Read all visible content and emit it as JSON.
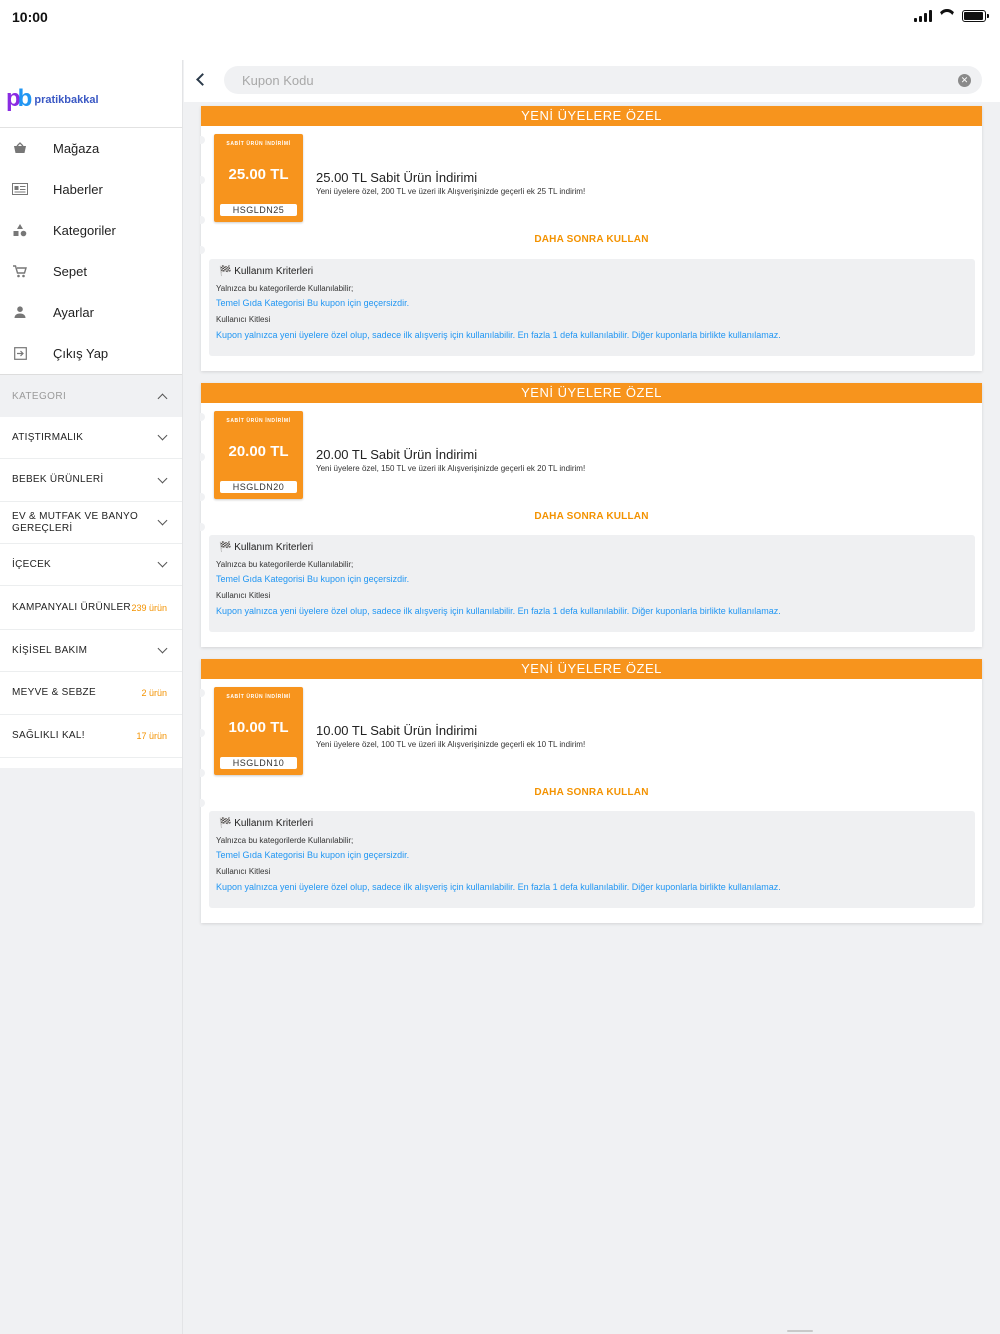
{
  "status": {
    "time": "10:00",
    "battery_level": 0.95
  },
  "brand": {
    "logo_text": "pratikbakkal"
  },
  "menu": [
    {
      "label": "Mağaza",
      "icon": "basket-icon"
    },
    {
      "label": "Haberler",
      "icon": "newspaper-icon"
    },
    {
      "label": "Kategoriler",
      "icon": "shapes-icon"
    },
    {
      "label": "Sepet",
      "icon": "cart-icon"
    },
    {
      "label": "Ayarlar",
      "icon": "person-icon"
    },
    {
      "label": "Çıkış Yap",
      "icon": "logout-icon"
    }
  ],
  "categories": {
    "header": "KATEGORI",
    "items": [
      {
        "label": "ATIŞTIRMALIK",
        "count": ""
      },
      {
        "label": "BEBEK ÜRÜNLERİ",
        "count": ""
      },
      {
        "label": "EV & MUTFAK VE BANYO GEREÇLERİ",
        "count": ""
      },
      {
        "label": "İÇECEK",
        "count": ""
      },
      {
        "label": "KAMPANYALI ÜRÜNLER",
        "count": "239 ürün"
      },
      {
        "label": "KİŞİSEL BAKIM",
        "count": ""
      },
      {
        "label": "MEYVE & SEBZE",
        "count": "2 ürün"
      },
      {
        "label": "SAĞLIKLI KAL!",
        "count": "17 ürün"
      }
    ]
  },
  "search": {
    "placeholder": "Kupon Kodu",
    "value": ""
  },
  "coupons": [
    {
      "ribbon": "YENİ ÜYELERE ÖZEL",
      "badge": "SABİT ÜRÜN İNDİRİMİ",
      "amount": "25.00 TL",
      "code": "HSGLDN25",
      "title": "25.00 TL Sabit Ürün İndirimi",
      "description": "Yeni üyelere özel, 200 TL ve üzeri ilk Alışverişinizde geçerli ek 25 TL indirim!",
      "action": "DAHA SONRA KULLAN",
      "criteria_title": "🏁 Kullanım Kriterleri",
      "categories_label": "Yalnızca bu kategorilerde Kullanılabilir;",
      "categories_value": "Temel Gıda Kategorisi Bu kupon için geçersizdir.",
      "audience_label": "Kullanıcı Kitlesi",
      "audience_value": "Kupon yalnızca yeni üyelere özel olup, sadece ilk alışveriş için kullanılabilir. En fazla 1 defa kullanılabilir. Diğer kuponlarla birlikte kullanılamaz."
    },
    {
      "ribbon": "YENİ ÜYELERE ÖZEL",
      "badge": "SABİT ÜRÜN İNDİRİMİ",
      "amount": "20.00 TL",
      "code": "HSGLDN20",
      "title": "20.00 TL Sabit Ürün İndirimi",
      "description": "Yeni üyelere özel, 150 TL ve üzeri ilk Alışverişinizde geçerli ek 20 TL indirim!",
      "action": "DAHA SONRA KULLAN",
      "criteria_title": "🏁 Kullanım Kriterleri",
      "categories_label": "Yalnızca bu kategorilerde Kullanılabilir;",
      "categories_value": "Temel Gıda Kategorisi Bu kupon için geçersizdir.",
      "audience_label": "Kullanıcı Kitlesi",
      "audience_value": "Kupon yalnızca yeni üyelere özel olup, sadece ilk alışveriş için kullanılabilir. En fazla 1 defa kullanılabilir. Diğer kuponlarla birlikte kullanılamaz."
    },
    {
      "ribbon": "YENİ ÜYELERE ÖZEL",
      "badge": "SABİT ÜRÜN İNDİRİMİ",
      "amount": "10.00 TL",
      "code": "HSGLDN10",
      "title": "10.00 TL Sabit Ürün İndirimi",
      "description": "Yeni üyelere özel, 100 TL ve üzeri ilk Alışverişinizde geçerli ek 10 TL indirim!",
      "action": "DAHA SONRA KULLAN",
      "criteria_title": "🏁 Kullanım Kriterleri",
      "categories_label": "Yalnızca bu kategorilerde Kullanılabilir;",
      "categories_value": "Temel Gıda Kategorisi Bu kupon için geçersizdir.",
      "audience_label": "Kullanıcı Kitlesi",
      "audience_value": "Kupon yalnızca yeni üyelere özel olup, sadece ilk alışveriş için kullanılabilir. En fazla 1 defa kullanılabilir. Diğer kuponlarla birlikte kullanılamaz."
    }
  ],
  "colors": {
    "accent": "#f7941d",
    "link": "#2196f3",
    "background": "#f0f1f3"
  }
}
